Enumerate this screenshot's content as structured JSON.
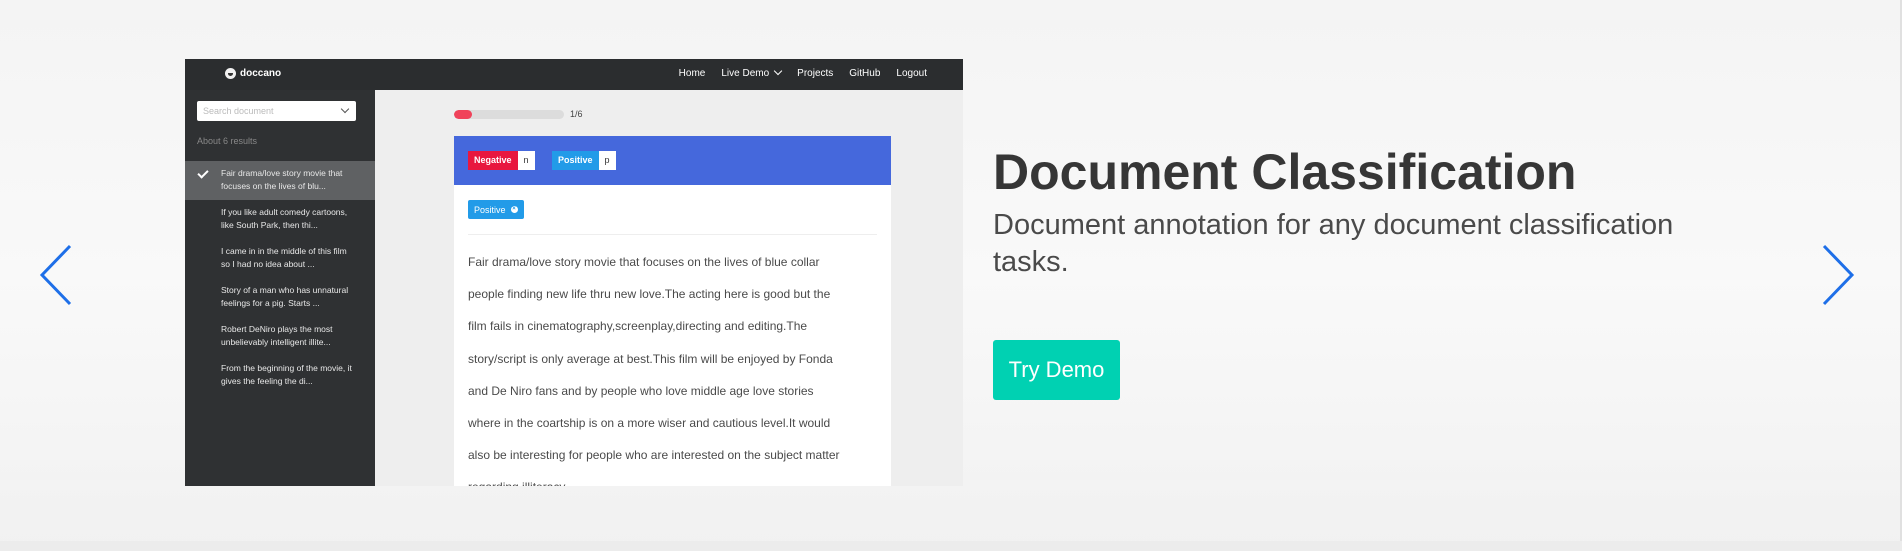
{
  "screenshot": {
    "brand": "doccano",
    "nav": {
      "home": "Home",
      "live_demo": "Live Demo",
      "projects": "Projects",
      "github": "GitHub",
      "logout": "Logout"
    },
    "search_placeholder": "Search document",
    "results_text": "About 6 results",
    "documents": [
      {
        "line1": "Fair drama/love story movie that",
        "line2": "focuses on the lives of blu..."
      },
      {
        "line1": "If you like adult comedy cartoons,",
        "line2": "like South Park, then thi..."
      },
      {
        "line1": "I came in in the middle of this film",
        "line2": "so I had no idea about ..."
      },
      {
        "line1": "Story of a man who has unnatural",
        "line2": "feelings for a pig. Starts ..."
      },
      {
        "line1": "Robert DeNiro plays the most",
        "line2": "unbelievably intelligent illite..."
      },
      {
        "line1": "From the beginning of the movie, it",
        "line2": "gives the feeling the di..."
      }
    ],
    "progress": {
      "label": "1/6",
      "fraction": 0.167
    },
    "labels": [
      {
        "name": "Negative",
        "key": "n",
        "color": "#e8173f"
      },
      {
        "name": "Positive",
        "key": "p",
        "color": "#229be8"
      }
    ],
    "selected_tag": "Positive",
    "document_lines": [
      "Fair drama/love story movie that focuses on the lives of blue collar",
      "people finding new life thru new love.The acting here is good but the",
      "film fails in cinematography,screenplay,directing and editing.The",
      "story/script is only average at best.This film will be enjoyed by Fonda",
      "and De Niro fans and by people who love middle age love stories",
      "where in the coartship is on a more wiser and cautious level.It would",
      "also be interesting for people who are interested on the subject matter",
      "regarding illiteracy......"
    ],
    "header_color": "#4568dc"
  },
  "hero": {
    "title": "Document Classification",
    "subtitle": "Document annotation for any document classification tasks.",
    "cta": "Try Demo",
    "cta_color": "#00d1b2",
    "arrow_color": "#1e6fe8"
  }
}
